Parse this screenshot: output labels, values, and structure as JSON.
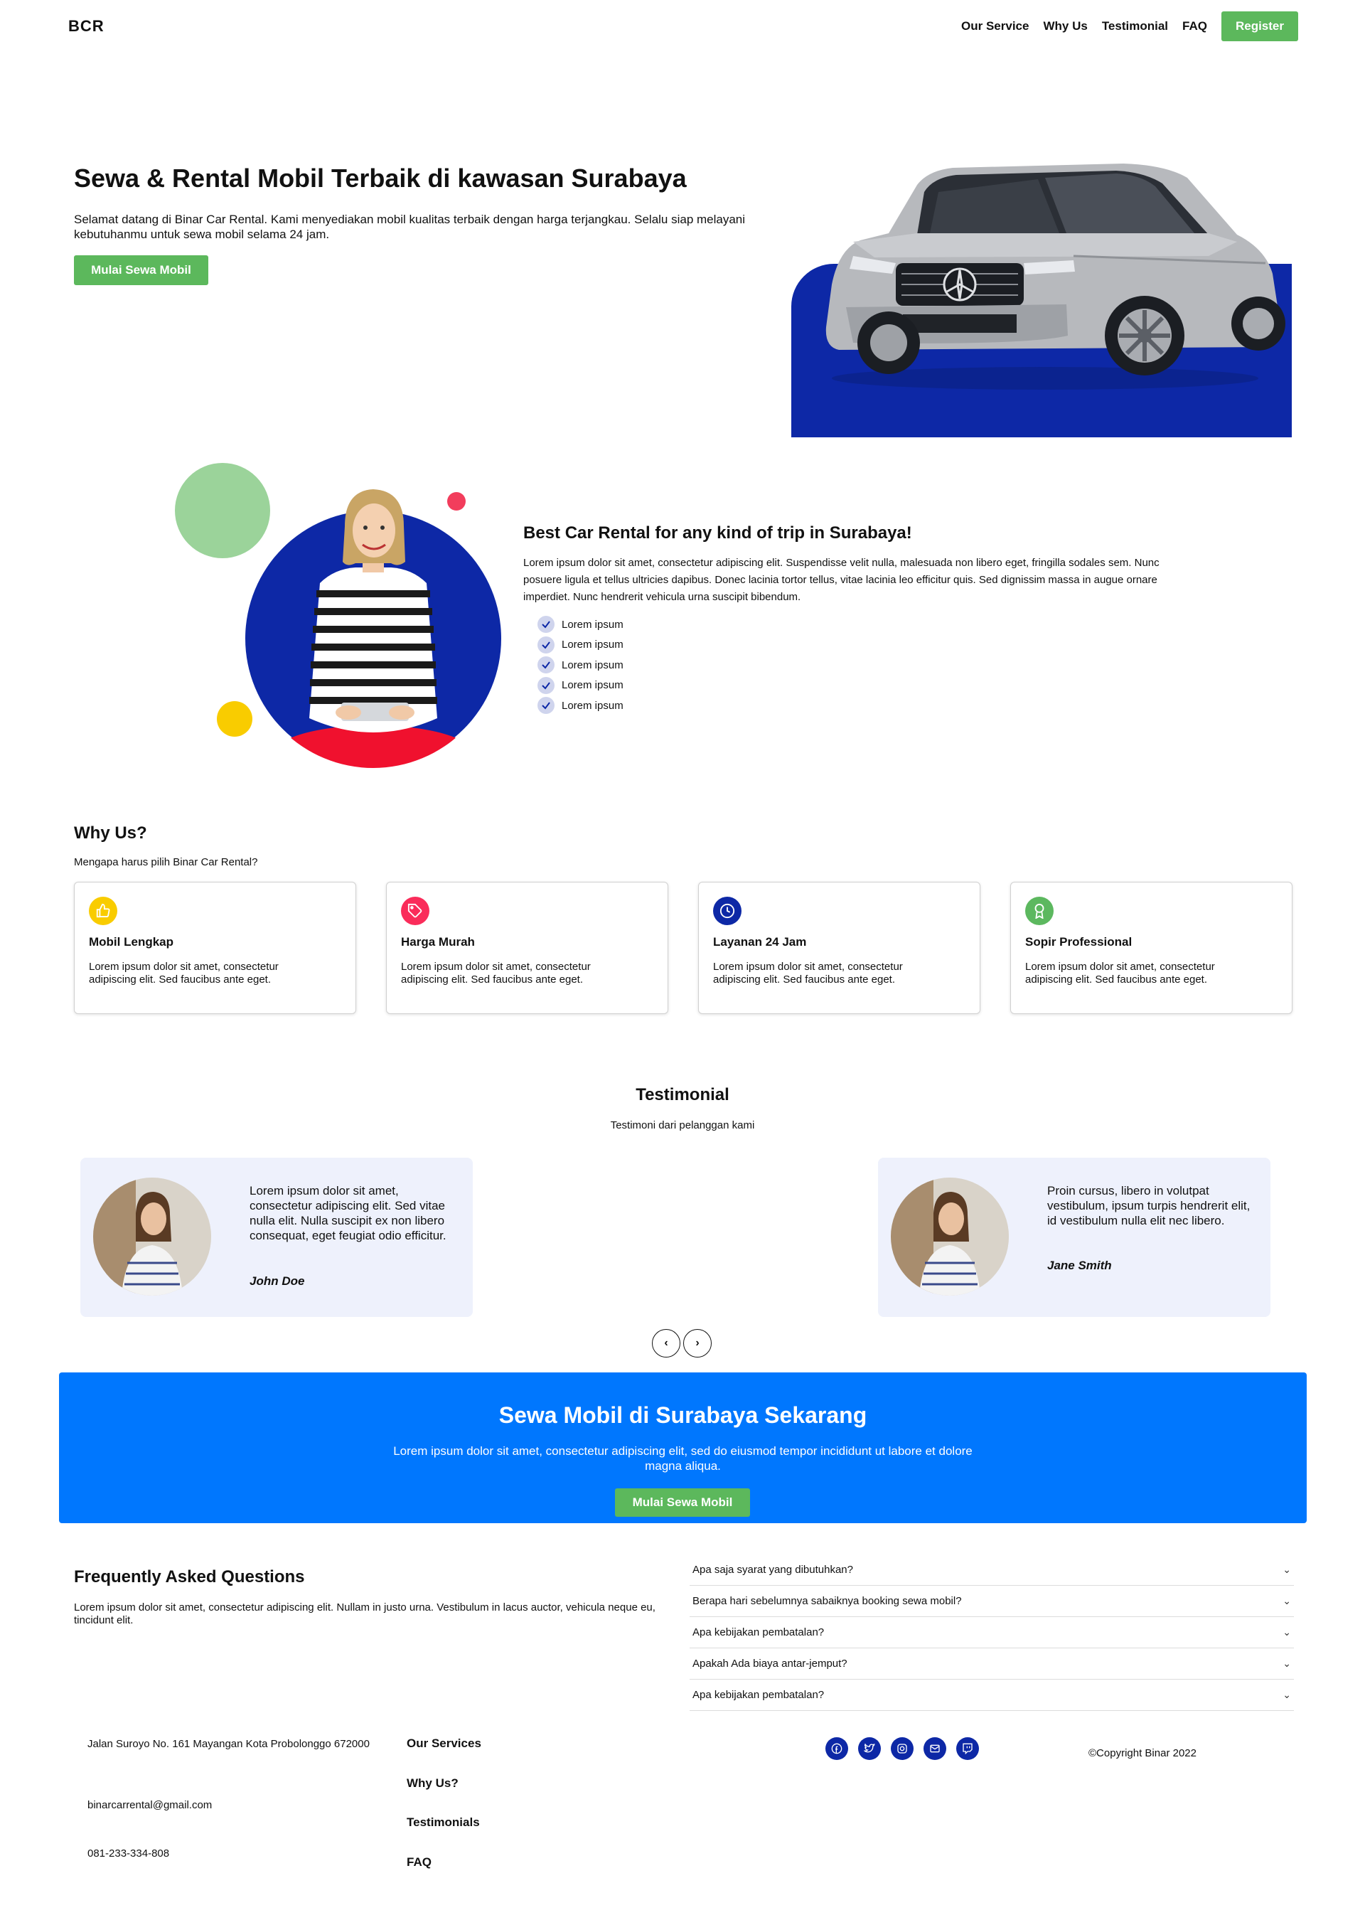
{
  "nav": {
    "brand": "BCR",
    "links": [
      "Our Service",
      "Why Us",
      "Testimonial",
      "FAQ"
    ],
    "register": "Register"
  },
  "hero": {
    "title": "Sewa & Rental Mobil Terbaik di kawasan Surabaya",
    "description": "Selamat datang di Binar Car Rental. Kami menyediakan mobil kualitas terbaik dengan harga terjangkau. Selalu siap melayani kebutuhanmu untuk sewa mobil selama 24 jam.",
    "cta": "Mulai Sewa Mobil"
  },
  "about": {
    "title": "Best Car Rental for any kind of trip in Surabaya!",
    "description": "Lorem ipsum dolor sit amet, consectetur adipiscing elit. Suspendisse velit nulla, malesuada non libero eget, fringilla sodales sem. Nunc posuere ligula et tellus ultricies dapibus. Donec lacinia tortor tellus, vitae lacinia leo efficitur quis. Sed dignissim massa in augue ornare imperdiet. Nunc hendrerit vehicula urna suscipit bibendum.",
    "items": [
      "Lorem ipsum",
      "Lorem ipsum",
      "Lorem ipsum",
      "Lorem ipsum",
      "Lorem ipsum"
    ]
  },
  "why": {
    "title": "Why Us?",
    "subtitle": "Mengapa harus pilih Binar Car Rental?",
    "cards": [
      {
        "icon": "thumbs-up-icon",
        "color": "#f9cc00",
        "title": "Mobil Lengkap",
        "desc": "Lorem ipsum dolor sit amet, consectetur adipiscing elit. Sed faucibus ante eget."
      },
      {
        "icon": "price-tag-icon",
        "color": "#fa2c5a",
        "title": "Harga Murah",
        "desc": "Lorem ipsum dolor sit amet, consectetur adipiscing elit. Sed faucibus ante eget."
      },
      {
        "icon": "clock-icon",
        "color": "#0d28a6",
        "title": "Layanan 24 Jam",
        "desc": "Lorem ipsum dolor sit amet, consectetur adipiscing elit. Sed faucibus ante eget."
      },
      {
        "icon": "award-icon",
        "color": "#5cb85f",
        "title": "Sopir Professional",
        "desc": "Lorem ipsum dolor sit amet, consectetur adipiscing elit. Sed faucibus ante eget."
      }
    ]
  },
  "testimonial": {
    "title": "Testimonial",
    "subtitle": "Testimoni dari pelanggan kami",
    "items": [
      {
        "text": "Lorem ipsum dolor sit amet, consectetur adipiscing elit. Sed vitae nulla elit. Nulla suscipit ex non libero consequat, eget feugiat odio efficitur.",
        "name": "John Doe"
      },
      {
        "text": "Proin cursus, libero in volutpat vestibulum, ipsum turpis hendrerit elit, id vestibulum nulla elit nec libero.",
        "name": "Jane Smith"
      }
    ],
    "prev": "‹",
    "next": "›"
  },
  "cta": {
    "title": "Sewa Mobil di Surabaya Sekarang",
    "description": "Lorem ipsum dolor sit amet, consectetur adipiscing elit, sed do eiusmod tempor incididunt ut labore et dolore magna aliqua.",
    "button": "Mulai Sewa Mobil"
  },
  "faq": {
    "title": "Frequently Asked Questions",
    "description": "Lorem ipsum dolor sit amet, consectetur adipiscing elit. Nullam in justo urna. Vestibulum in lacus auctor, vehicula neque eu, tincidunt elit.",
    "questions": [
      "Apa saja syarat yang dibutuhkan?",
      "Berapa hari sebelumnya sabaiknya booking sewa mobil?",
      "Apa kebijakan pembatalan?",
      "Apakah Ada biaya antar-jemput?",
      "Apa kebijakan pembatalan?"
    ]
  },
  "footer": {
    "address": "Jalan Suroyo No. 161 Mayangan Kota Probolonggo 672000",
    "email": "binarcarrental@gmail.com",
    "phone": "081-233-334-808",
    "links": [
      "Our Services",
      "Why Us?",
      "Testimonials",
      "FAQ"
    ],
    "socials": [
      "facebook-icon",
      "twitter-icon",
      "instagram-icon",
      "mail-icon",
      "twitch-icon"
    ],
    "copyright": "©Copyright Binar 2022"
  },
  "colors": {
    "primary_blue": "#0d28a6",
    "cta_blue": "#0077fe",
    "green": "#5cb85c",
    "card_bg": "#eef1fc"
  }
}
